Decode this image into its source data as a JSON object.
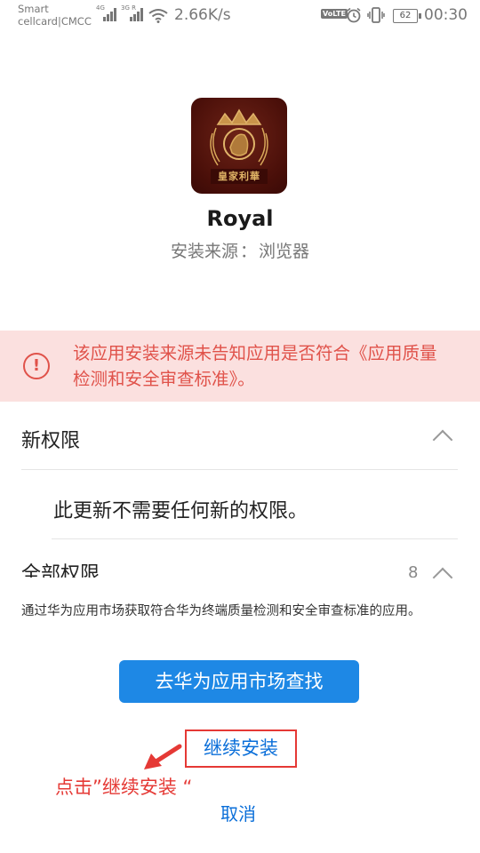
{
  "status_bar": {
    "carrier_line1": "Smart",
    "carrier_line2": "cellcard|CMCC",
    "sim1_tag": "4G",
    "sim2_tag": "3G R",
    "network_speed": "2.66K/s",
    "volte": "VoLTE",
    "battery": "62",
    "time": "00:30"
  },
  "app": {
    "icon_text": "皇家利華",
    "name": "Royal",
    "source_label": "安装来源",
    "source_sep": "：",
    "source_value": "浏览器"
  },
  "warning": {
    "icon": "!",
    "text": "该应用安装来源未告知应用是否符合《应用质量检测和安全审查标准》。"
  },
  "permissions": {
    "new_title": "新权限",
    "new_text": "此更新不需要任何新的权限。",
    "all_title": "全部权限",
    "all_count": "8"
  },
  "info_text": "通过华为应用市场获取符合华为终端质量检测和安全审查标准的应用。",
  "buttons": {
    "market": "去华为应用市场查找",
    "continue": "继续安装",
    "cancel": "取消"
  },
  "annotation": "点击”继续安装 “",
  "icons": {
    "warning": "exclamation-circle-icon",
    "chevron": "chevron-up-icon",
    "wifi": "wifi-icon",
    "alarm": "alarm-icon",
    "vibrate": "vibrate-icon",
    "arrow": "red-arrow-icon"
  },
  "colors": {
    "warning_bg": "#fbe0df",
    "warning_text": "#e0524a",
    "primary_button": "#1e88e5",
    "link": "#0b6fd9",
    "annotation": "#e53935"
  }
}
